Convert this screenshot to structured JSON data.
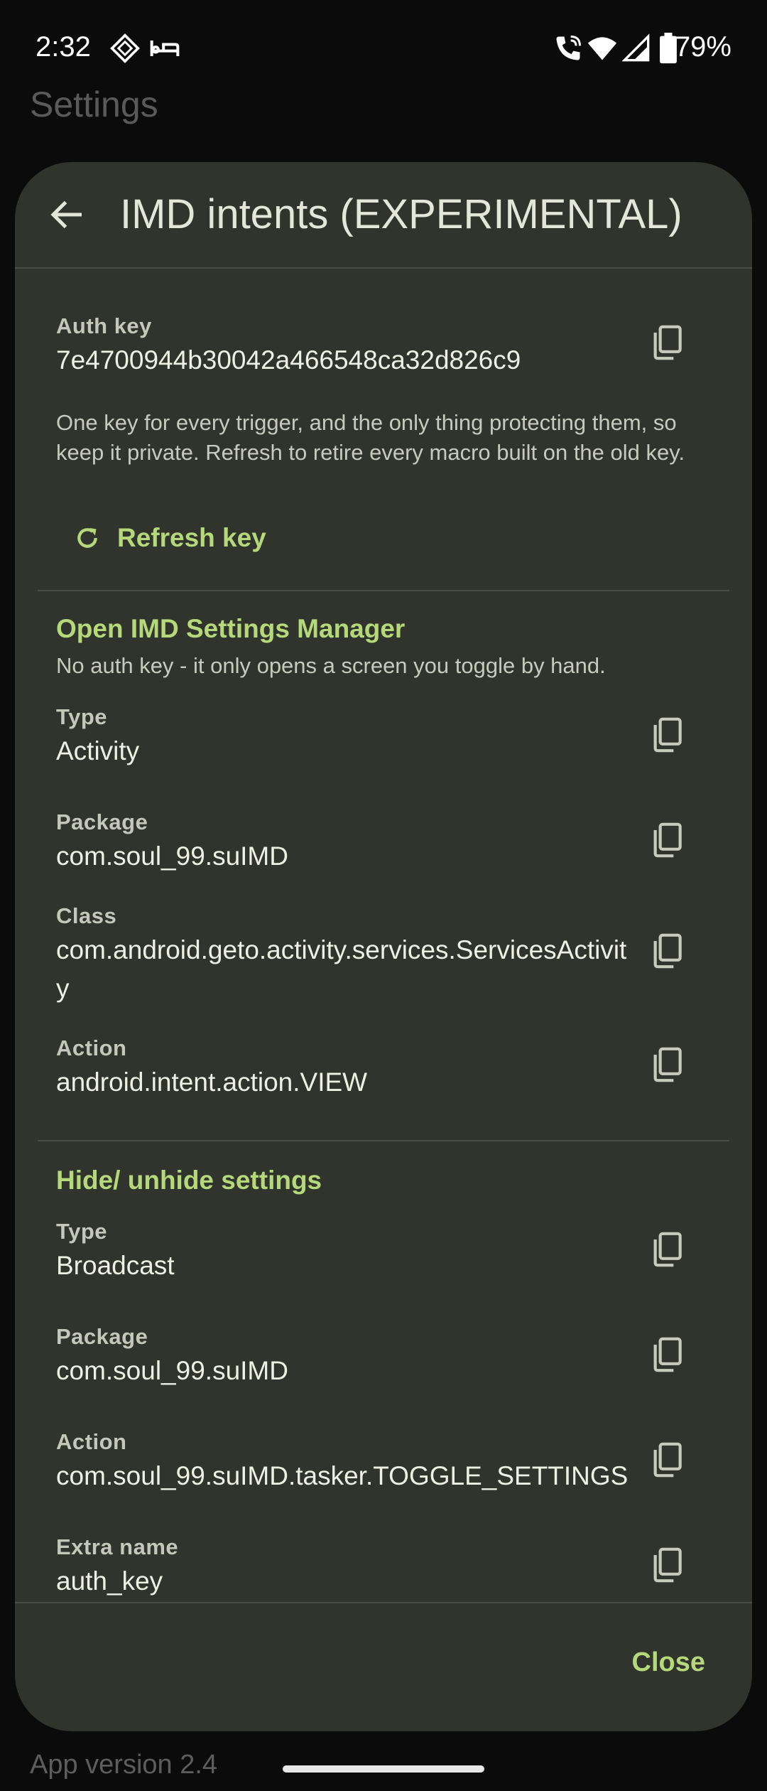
{
  "status": {
    "time": "2:32",
    "battery": "79%"
  },
  "background": {
    "title": "Settings",
    "footer": "App version 2.4"
  },
  "dialog": {
    "title": "IMD intents (EXPERIMENTAL)",
    "close_label": "Close",
    "auth": {
      "label": "Auth key",
      "value": "7e4700944b30042a466548ca32d826c9",
      "description": "One key for every trigger, and the only thing protecting them, so keep it private. Refresh to retire every macro built on the old key.",
      "refresh_label": "Refresh key"
    },
    "section1": {
      "title": "Open IMD Settings Manager",
      "note": "No auth key - it only opens a screen you toggle by hand.",
      "fields": [
        {
          "label": "Type",
          "value": "Activity"
        },
        {
          "label": "Package",
          "value": "com.soul_99.suIMD"
        },
        {
          "label": "Class",
          "value": "com.android.geto.activity.services.ServicesActivity"
        },
        {
          "label": "Action",
          "value": "android.intent.action.VIEW"
        }
      ]
    },
    "section2": {
      "title": "Hide/ unhide settings",
      "fields": [
        {
          "label": "Type",
          "value": "Broadcast"
        },
        {
          "label": "Package",
          "value": "com.soul_99.suIMD"
        },
        {
          "label": "Action",
          "value": "com.soul_99.suIMD.tasker.TOGGLE_SETTINGS"
        },
        {
          "label": "Extra name",
          "value": "auth_key"
        }
      ]
    }
  },
  "icons": {
    "back": "arrow-back-icon",
    "copy": "copy-icon",
    "refresh": "refresh-icon",
    "accent_color": "#b4d87a"
  }
}
